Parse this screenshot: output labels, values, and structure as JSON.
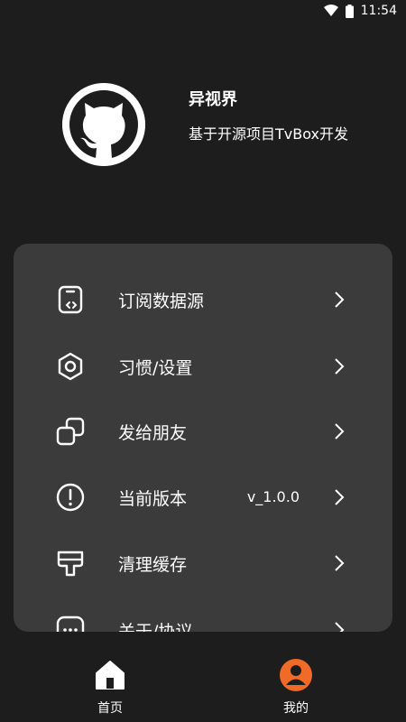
{
  "status_bar": {
    "time": "11:54"
  },
  "profile": {
    "app_name": "异视界",
    "description": "基于开源项目TvBox开发",
    "avatar_icon": "github-octocat-icon"
  },
  "menu": [
    {
      "label": "订阅数据源",
      "icon": "subscription-source-icon",
      "value": ""
    },
    {
      "label": "习惯/设置",
      "icon": "settings-hex-icon",
      "value": ""
    },
    {
      "label": "发给朋友",
      "icon": "share-squares-icon",
      "value": ""
    },
    {
      "label": "当前版本",
      "icon": "info-exclamation-icon",
      "value": "v_1.0.0"
    },
    {
      "label": "清理缓存",
      "icon": "brush-clean-icon",
      "value": ""
    },
    {
      "label": "关于/协议",
      "icon": "chat-dots-icon",
      "value": ""
    }
  ],
  "bottom_nav": {
    "home_label": "首页",
    "mine_label": "我的",
    "active_color": "#f06a28"
  },
  "colors": {
    "background": "#1d1d1d",
    "card": "#3b3b3b",
    "accent": "#f06a28"
  }
}
